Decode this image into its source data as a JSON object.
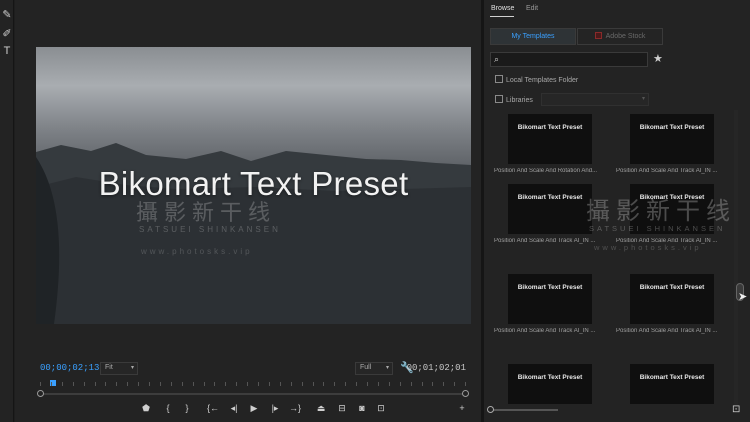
{
  "tools": [
    {
      "icon": "pen-icon",
      "glyph": "✎"
    },
    {
      "icon": "pencil-icon",
      "glyph": "✐"
    },
    {
      "icon": "type-tool-icon",
      "glyph": "T"
    }
  ],
  "monitor": {
    "video_title": "Bikomart Text Preset",
    "watermark_cn": "攝影新干线",
    "watermark_en": "SATSUEI SHINKANSEN",
    "watermark_url": "www.photosks.vip",
    "timecode_current": "00;00;02;13",
    "timecode_duration": "00;01;02;01",
    "zoom_select": "Fit",
    "resolution_select": "Full",
    "transport": [
      {
        "name": "add-marker-button",
        "icon": "marker-icon",
        "glyph": "⬟"
      },
      {
        "name": "mark-in-button",
        "icon": "mark-in-icon",
        "glyph": "{"
      },
      {
        "name": "mark-out-button",
        "icon": "mark-out-icon",
        "glyph": "}"
      },
      {
        "name": "go-to-in-button",
        "icon": "go-to-in-icon",
        "glyph": "{←"
      },
      {
        "name": "step-back-button",
        "icon": "step-back-icon",
        "glyph": "◂|"
      },
      {
        "name": "play-button",
        "icon": "play-icon",
        "glyph": "▶"
      },
      {
        "name": "step-forward-button",
        "icon": "step-forward-icon",
        "glyph": "|▸"
      },
      {
        "name": "go-to-out-button",
        "icon": "go-to-out-icon",
        "glyph": "→}"
      },
      {
        "name": "lift-button",
        "icon": "lift-icon",
        "glyph": "⏏"
      },
      {
        "name": "extract-button",
        "icon": "extract-icon",
        "glyph": "⊟"
      },
      {
        "name": "export-frame-button",
        "icon": "camera-icon",
        "glyph": "◙"
      },
      {
        "name": "compare-view-button",
        "icon": "compare-icon",
        "glyph": "⊡"
      },
      {
        "name": "add-button",
        "icon": "plus-icon",
        "glyph": "+"
      }
    ]
  },
  "panel": {
    "tabs": [
      "Browse",
      "Edit"
    ],
    "segments": [
      "My Templates",
      "Adobe Stock"
    ],
    "checkbox_local": "Local Templates Folder",
    "checkbox_libraries": "Libraries",
    "watermark_cn": "攝影新干线",
    "watermark_en": "SATSUEI SHINKANSEN",
    "watermark_url": "www.photosks.vip",
    "templates": [
      {
        "name": "Bikomart Text Preset",
        "caption": "Position And Scale And Rotation And..."
      },
      {
        "name": "Bikomart Text Preset",
        "caption": "Position And Scale And Track AI_IN ..."
      },
      {
        "name": "Bikomart Text Preset",
        "caption": "Position And Scale And Track AI_IN ..."
      },
      {
        "name": "Bikomart Text Preset",
        "caption": "Position And Scale And Track AI_IN ..."
      },
      {
        "name": "Bikomart Text Preset",
        "caption": "Position And Scale And Track AI_IN ..."
      },
      {
        "name": "Bikomart Text Preset",
        "caption": "Position And Scale And Track AI_IN ..."
      },
      {
        "name": "Bikomart Text Preset",
        "caption": ""
      },
      {
        "name": "Bikomart Text Preset",
        "caption": ""
      }
    ]
  }
}
